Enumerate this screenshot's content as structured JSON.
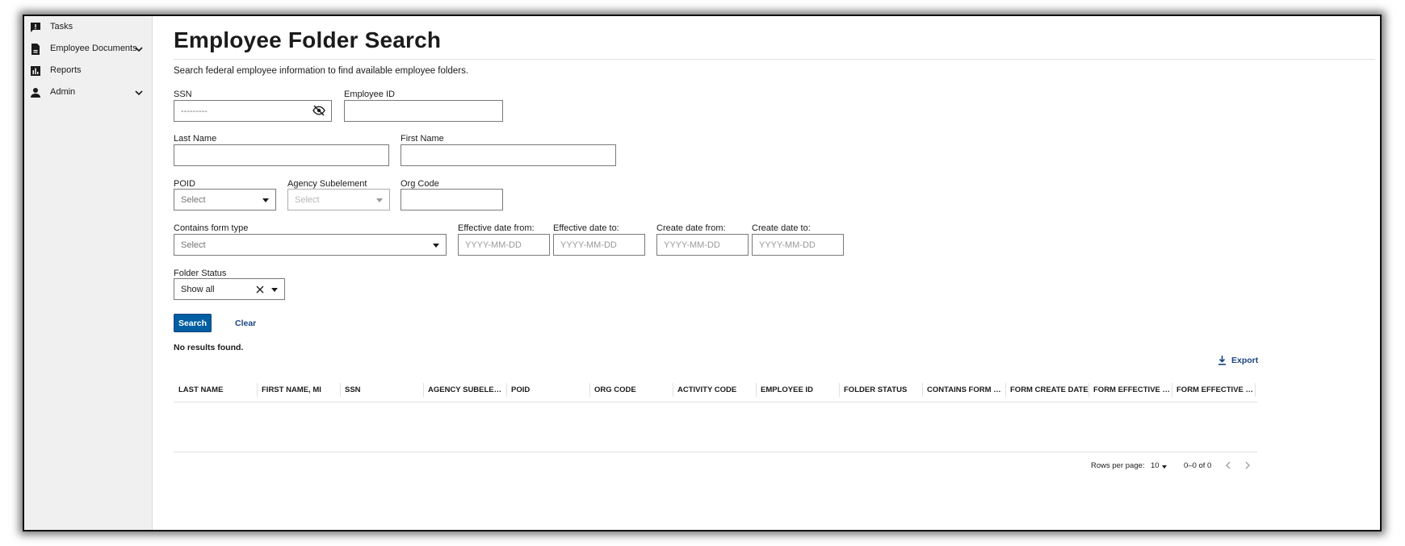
{
  "sidebar": {
    "items": [
      {
        "label": "Tasks",
        "icon": "tasks-icon"
      },
      {
        "label": "Employee Documents",
        "icon": "document-icon",
        "expandable": true
      },
      {
        "label": "Reports",
        "icon": "bar-chart-icon"
      },
      {
        "label": "Admin",
        "icon": "person-icon",
        "expandable": true
      }
    ]
  },
  "page": {
    "title": "Employee Folder Search",
    "subtitle": "Search federal employee information to find available employee folders."
  },
  "form": {
    "ssn": {
      "label": "SSN",
      "value": "---------"
    },
    "employee_id": {
      "label": "Employee ID",
      "value": ""
    },
    "last_name": {
      "label": "Last Name",
      "value": ""
    },
    "first_name": {
      "label": "First Name",
      "value": ""
    },
    "poid": {
      "label": "POID",
      "value": "Select"
    },
    "agency_subelement": {
      "label": "Agency Subelement",
      "value": "Select",
      "disabled": true
    },
    "org_code": {
      "label": "Org Code",
      "value": ""
    },
    "form_type": {
      "label": "Contains form type",
      "value": "Select"
    },
    "effective_from": {
      "label": "Effective date from:",
      "placeholder": "YYYY-MM-DD"
    },
    "effective_to": {
      "label": "Effective date to:",
      "placeholder": "YYYY-MM-DD"
    },
    "create_from": {
      "label": "Create date from:",
      "placeholder": "YYYY-MM-DD"
    },
    "create_to": {
      "label": "Create date to:",
      "placeholder": "YYYY-MM-DD"
    },
    "folder_status": {
      "label": "Folder Status",
      "value": "Show all"
    }
  },
  "actions": {
    "search_label": "Search",
    "clear_label": "Clear"
  },
  "results": {
    "message": "No results found.",
    "export_label": "Export",
    "columns": [
      "LAST NAME",
      "FIRST NAME, MI",
      "SSN",
      "AGENCY SUBELEME...",
      "POID",
      "ORG CODE",
      "ACTIVITY CODE",
      "EMPLOYEE ID",
      "FOLDER STATUS",
      "CONTAINS FORM TY...",
      "FORM CREATE DATE",
      "FORM EFFECTIVE FR...",
      "FORM EFFECTIVE TO"
    ]
  },
  "pagination": {
    "rows_per_page_label": "Rows per page:",
    "rows_per_page": "10",
    "range": "0–0 of 0"
  },
  "colors": {
    "primary": "#005ea2",
    "link": "#1a4480",
    "sidebar_bg": "#f0f0f0"
  }
}
